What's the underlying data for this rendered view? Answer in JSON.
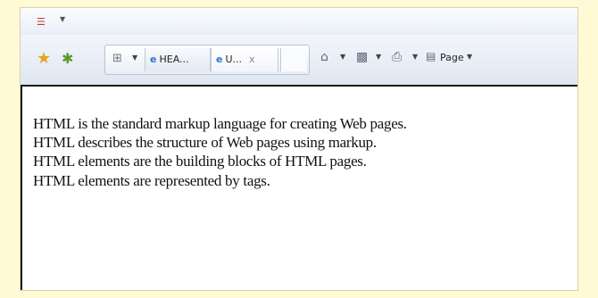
{
  "toolbar": {
    "tab_active_label": "HEA...",
    "tab_inactive_label": "U...",
    "tab_close_label": "x",
    "page_label": "Page"
  },
  "icons": {
    "favicon": "rss-feed-icon",
    "favorites": "star-icon",
    "add_favorites": "add-favorites-icon",
    "quick_tabs": "quick-tabs-icon",
    "home": "home-icon",
    "feeds": "feeds-icon",
    "print": "print-icon",
    "page": "page-icon"
  },
  "content": {
    "lines": [
      "HTML is the standard markup language for creating Web pages.",
      "HTML describes the structure of Web pages using markup.",
      "HTML elements are the building blocks of HTML pages.",
      "HTML elements are represented by tags."
    ]
  },
  "colors": {
    "page_background": "#fff9d6",
    "toolbar_background": "#dfe6f1",
    "ie_blue": "#2a78d4",
    "favorites_star": "#e8a31a"
  }
}
